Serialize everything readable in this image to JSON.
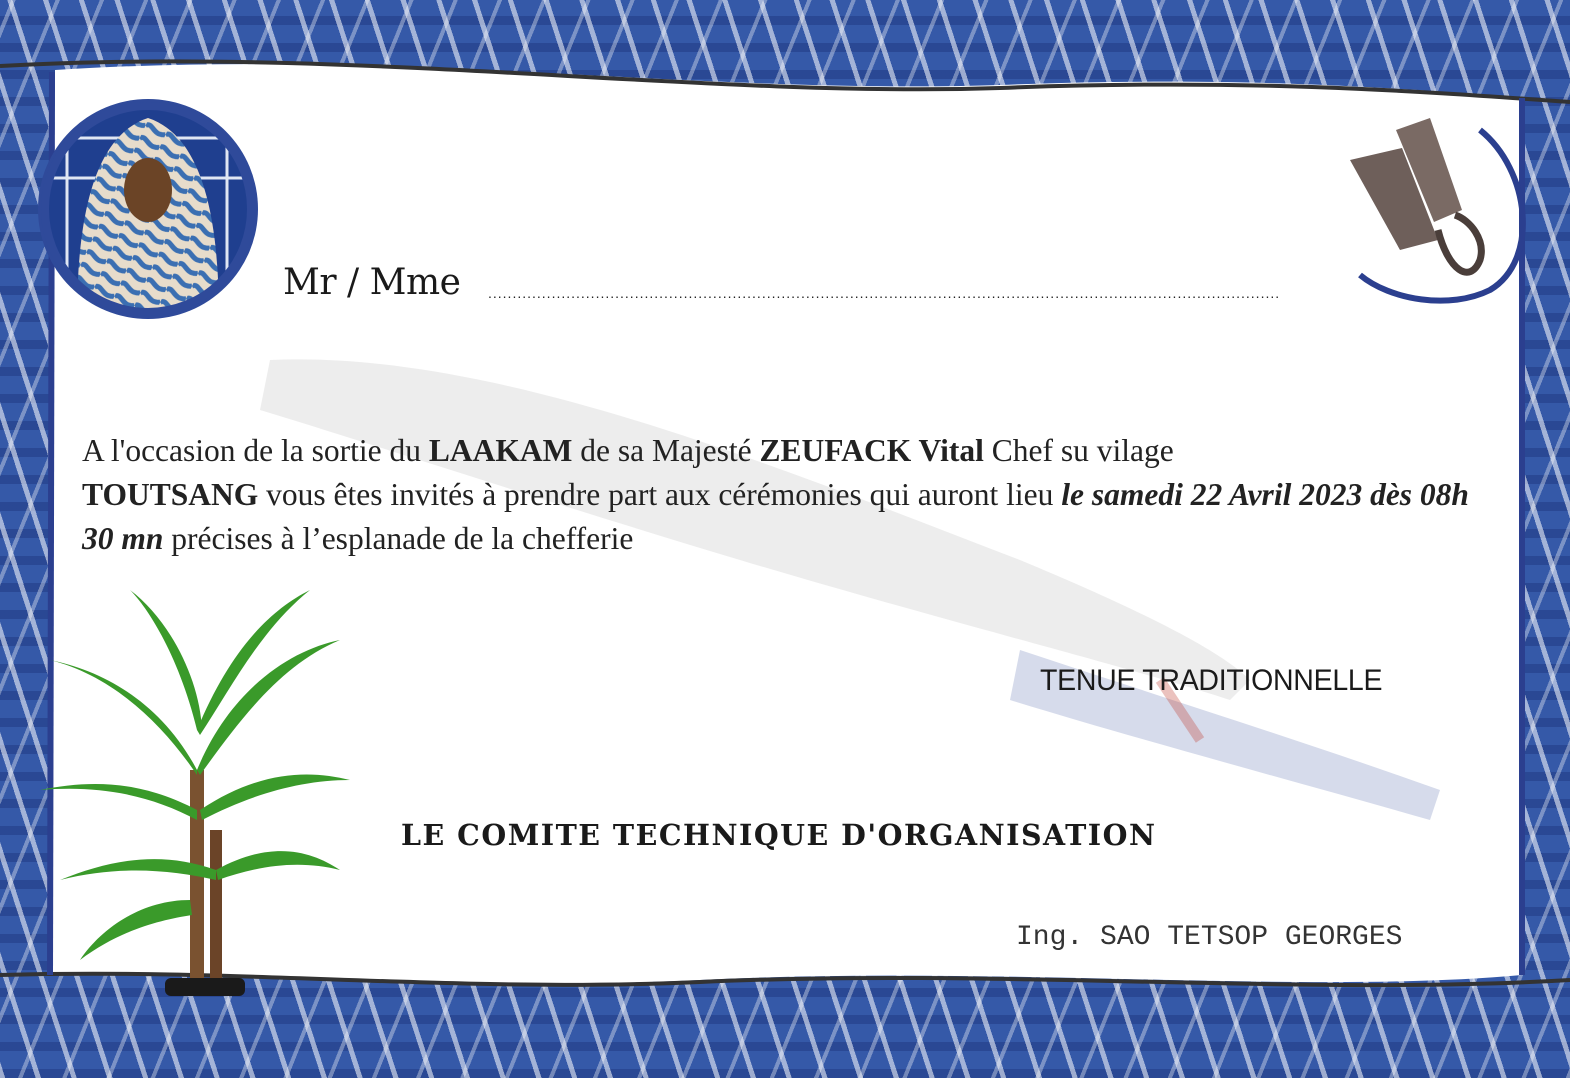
{
  "invitation": {
    "salutation": "Mr / Mme",
    "blank_line": "..................................................................................................................................................................",
    "body": {
      "part1": "A l'occasion de la sortie du ",
      "event_name": "LAAKAM",
      "part2": " de sa Majesté  ",
      "chief_name": "ZEUFACK Vital",
      "part3": " Chef su vilage",
      "village": "TOUTSANG",
      "part4": " vous êtes invités à prendre part aux cérémonies qui auront lieu ",
      "date_time": "le samedi 22 Avril 2023 dès 08h 30 mn",
      "part5": " précises à l’esplanade de la chefferie"
    },
    "dress_code": "TENUE TRADITIONNELLE",
    "committee": "LE COMITE TECHNIQUE D'ORGANISATION",
    "signatory": "Ing. SAO TETSOP GEORGES"
  },
  "images": {
    "portrait": "chief-portrait-photo",
    "bells": "double-iron-bell-icon",
    "broom": "ceremonial-whisk-watermark",
    "plant": "dracaena-plant-photo"
  },
  "colors": {
    "fabric_blue": "#2f55a4",
    "accent_blue": "#2b3f8f",
    "text": "#222222"
  }
}
